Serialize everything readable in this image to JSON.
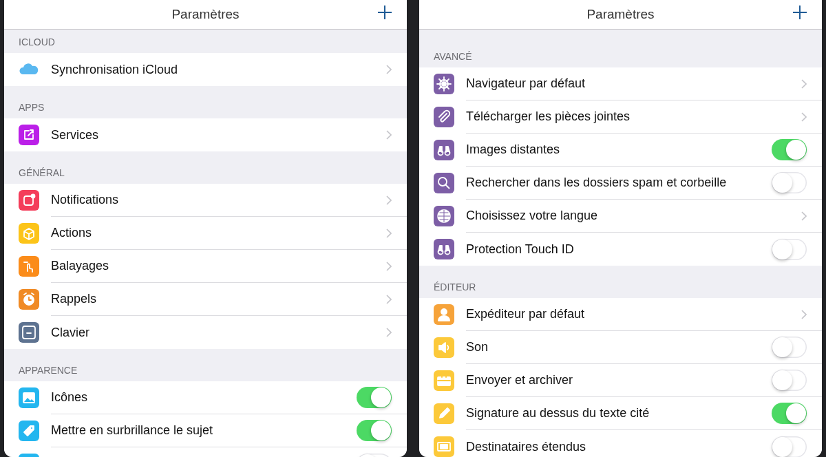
{
  "panels": [
    {
      "title": "Paramètres",
      "sections": [
        {
          "header": "ICLOUD",
          "rows": [
            {
              "label": "Synchronisation iCloud",
              "color": "#5ab8f0",
              "kind": "link"
            }
          ]
        },
        {
          "header": "APPS",
          "rows": [
            {
              "label": "Services",
              "color": "#bb1fe8",
              "kind": "link"
            }
          ]
        },
        {
          "header": "GÉNÉRAL",
          "rows": [
            {
              "label": "Notifications",
              "color": "#f43d5a",
              "kind": "link"
            },
            {
              "label": "Actions",
              "color": "#fcc419",
              "kind": "link"
            },
            {
              "label": "Balayages",
              "color": "#fb8c1a",
              "kind": "link"
            },
            {
              "label": "Rappels",
              "color": "#f08a24",
              "kind": "link"
            },
            {
              "label": "Clavier",
              "color": "#5d7290",
              "kind": "link"
            }
          ]
        },
        {
          "header": "APPARENCE",
          "rows": [
            {
              "label": "Icônes",
              "color": "#23b6ef",
              "kind": "toggle",
              "on": true
            },
            {
              "label": "Mettre en surbrillance le sujet",
              "color": "#23b6ef",
              "kind": "toggle",
              "on": true
            },
            {
              "color": "#23b6ef",
              "kind": "toggle",
              "on": false
            }
          ]
        }
      ]
    },
    {
      "title": "Paramètres",
      "sections": [
        {
          "header": "AVANCÉ",
          "rows": [
            {
              "label": "Navigateur par défaut",
              "color": "#7d5ea6",
              "kind": "link"
            },
            {
              "label": "Télécharger les pièces jointes",
              "color": "#7d5ea6",
              "kind": "link"
            },
            {
              "label": "Images distantes",
              "color": "#7d5ea6",
              "kind": "toggle",
              "on": true
            },
            {
              "label": "Rechercher dans les dossiers spam et corbeille",
              "color": "#7d5ea6",
              "kind": "toggle",
              "on": false
            },
            {
              "label": "Choisissez votre langue",
              "color": "#7d5ea6",
              "kind": "link"
            },
            {
              "label": "Protection Touch ID",
              "color": "#7d5ea6",
              "kind": "toggle",
              "on": false
            }
          ]
        },
        {
          "header": "ÉDITEUR",
          "rows": [
            {
              "label": "Expéditeur par défaut",
              "color": "#f6a33a",
              "kind": "link"
            },
            {
              "label": "Son",
              "color": "#fcc93a",
              "kind": "toggle",
              "on": false
            },
            {
              "label": "Envoyer et archiver",
              "color": "#fcc93a",
              "kind": "toggle",
              "on": false
            },
            {
              "label": "Signature au dessus du texte cité",
              "color": "#fcc93a",
              "kind": "toggle",
              "on": true
            },
            {
              "label": "Destinataires étendus",
              "color": "#fcc93a",
              "kind": "toggle",
              "on": false
            }
          ]
        }
      ]
    }
  ]
}
